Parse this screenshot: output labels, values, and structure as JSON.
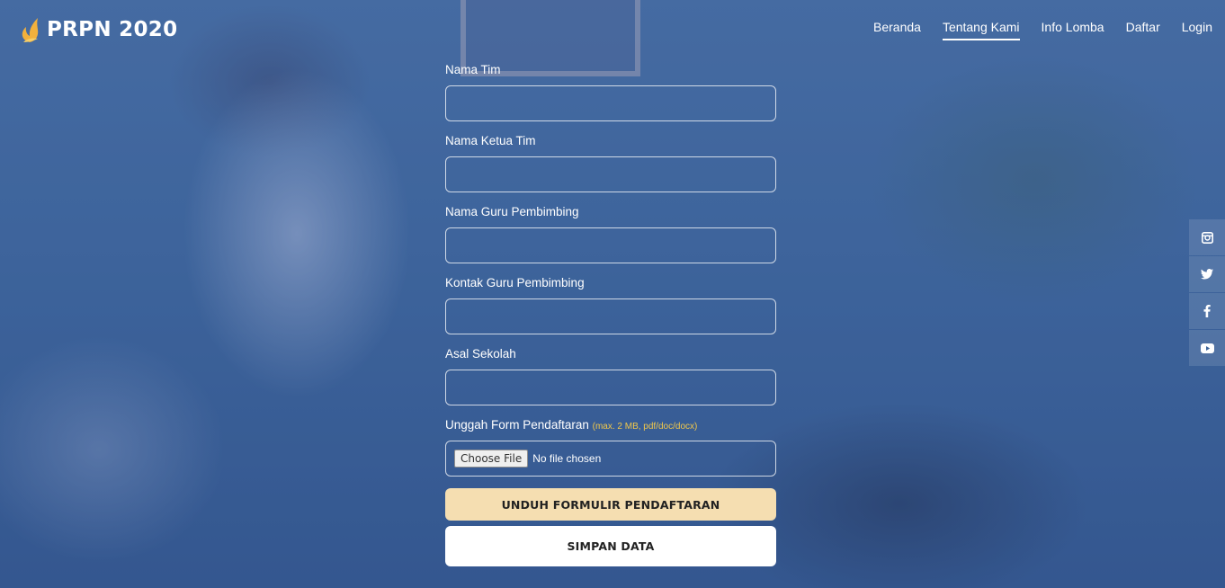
{
  "brand": {
    "name": "PRPN 2020"
  },
  "nav": {
    "items": [
      {
        "label": "Beranda"
      },
      {
        "label": "Tentang Kami"
      },
      {
        "label": "Info Lomba"
      },
      {
        "label": "Daftar"
      },
      {
        "label": "Login"
      }
    ],
    "active": "Tentang Kami"
  },
  "form": {
    "team_name_label": "Nama Tim",
    "team_leader_label": "Nama Ketua Tim",
    "teacher_name_label": "Nama Guru Pembimbing",
    "teacher_contact_label": "Kontak Guru Pembimbing",
    "school_label": "Asal Sekolah",
    "upload_label": "Unggah Form Pendaftaran",
    "upload_hint": "(max. 2 MB, pdf/doc/docx)",
    "file_button_label": "Choose File",
    "file_status": "No file chosen",
    "download_button_label": "UNDUH FORMULIR PENDAFTARAN",
    "save_button_label": "SIMPAN DATA"
  },
  "social": {
    "items": [
      {
        "icon": "instagram-icon"
      },
      {
        "icon": "twitter-icon"
      },
      {
        "icon": "facebook-icon"
      },
      {
        "icon": "youtube-icon"
      }
    ]
  },
  "colors": {
    "download_button": "#f5deb1",
    "upload_hint": "#f1c84b",
    "logo_accent": "#f2b13c"
  }
}
